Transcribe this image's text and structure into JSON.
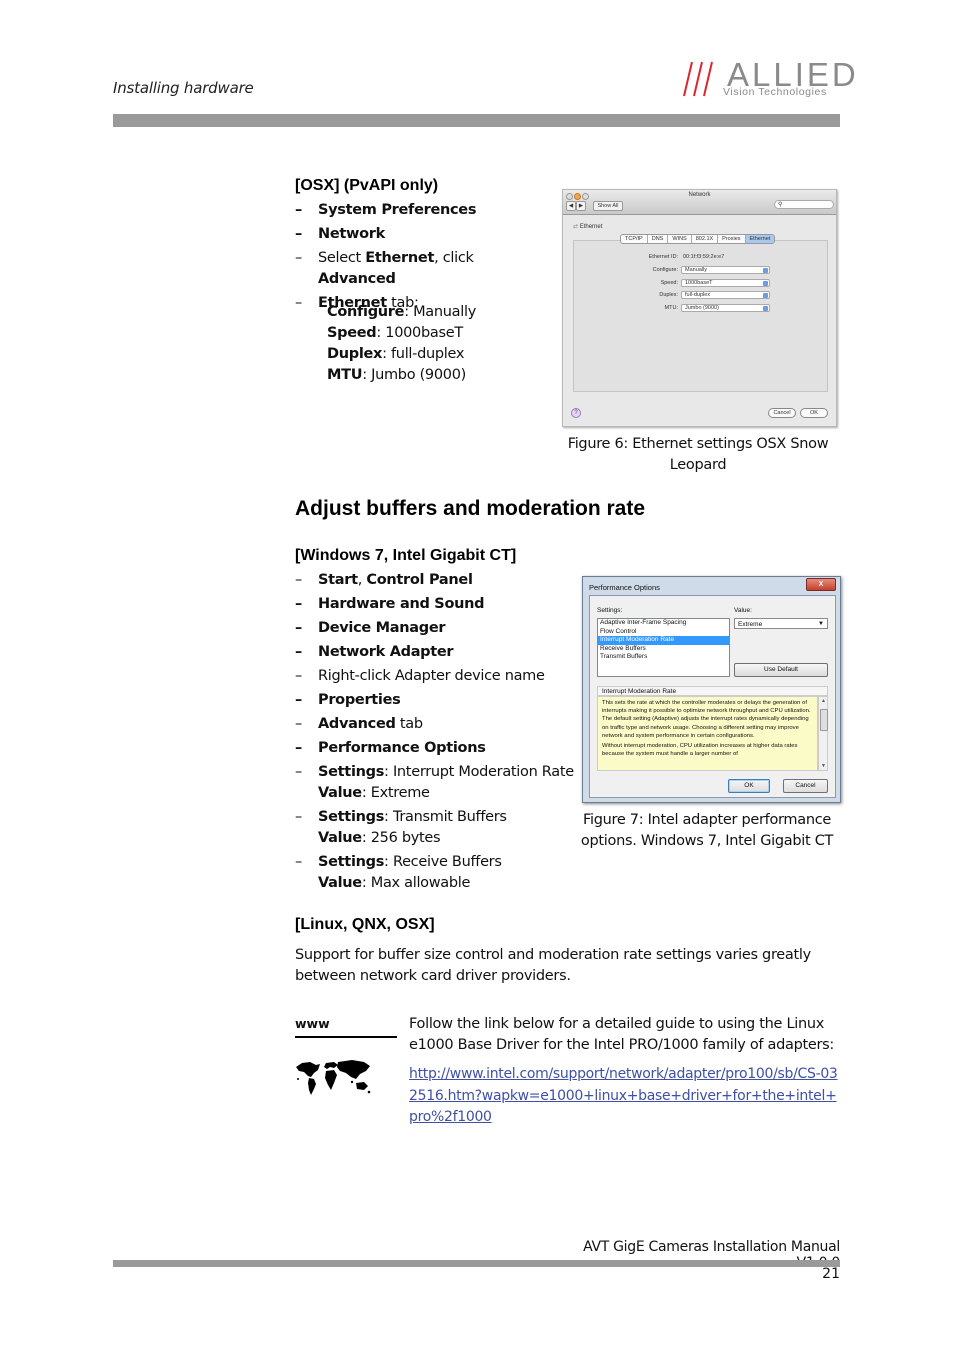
{
  "header": {
    "running_head": "Installing hardware",
    "logo": {
      "word": "ALLIED",
      "sub": "Vision Technologies",
      "slash_color": "#e0242e",
      "text_color": "#8a8a8a"
    }
  },
  "osx_section": {
    "heading": "[OSX] (PvAPI only)",
    "steps": [
      {
        "parts": [
          {
            "text": "System Preferences",
            "bold": true
          }
        ]
      },
      {
        "parts": [
          {
            "text": "Network",
            "bold": true
          }
        ]
      },
      {
        "parts": [
          {
            "text": "Select ",
            "bold": false
          },
          {
            "text": "Ethernet",
            "bold": true
          },
          {
            "text": ", click ",
            "bold": false
          },
          {
            "text": "Advanced",
            "bold": true
          }
        ]
      },
      {
        "parts": [
          {
            "text": "Ethernet",
            "bold": true
          },
          {
            "text": " tab:",
            "bold": false
          }
        ]
      }
    ],
    "params": [
      {
        "key": "Configure",
        "value": "Manually"
      },
      {
        "key": "Speed",
        "value": "1000baseT"
      },
      {
        "key": "Duplex",
        "value": "full-duplex"
      },
      {
        "key": "MTU",
        "value": "Jumbo (9000)"
      }
    ],
    "figure": {
      "window_title": "Network",
      "show_all": "Show All",
      "search_glyph": "⚲",
      "interface": "Ethernet",
      "tabs": [
        "TCP/IP",
        "DNS",
        "WINS",
        "802.1X",
        "Proxies",
        "Ethernet"
      ],
      "active_tab": "Ethernet",
      "ethernet_id_label": "Ethernet ID:",
      "ethernet_id": "00:1f:f3:59:2e:e7",
      "fields": [
        {
          "label": "Configure:",
          "value": "Manually"
        },
        {
          "label": "Speed:",
          "value": "1000baseT"
        },
        {
          "label": "Duplex:",
          "value": "full-duplex"
        },
        {
          "label": "MTU:",
          "value": "Jumbo (9000)"
        }
      ],
      "help": "?",
      "cancel": "Cancel",
      "ok": "OK"
    },
    "caption": "Figure 6: Ethernet settings OSX Snow Leopard"
  },
  "main_heading": "Adjust buffers and moderation rate",
  "win_section": {
    "heading": "[Windows 7, Intel Gigabit CT]",
    "steps": [
      {
        "parts": [
          {
            "text": "Start",
            "bold": true
          },
          {
            "text": ", ",
            "bold": false
          },
          {
            "text": "Control Panel",
            "bold": true
          }
        ]
      },
      {
        "parts": [
          {
            "text": "Hardware and Sound",
            "bold": true
          }
        ]
      },
      {
        "parts": [
          {
            "text": "Device Manager",
            "bold": true
          }
        ]
      },
      {
        "parts": [
          {
            "text": "Network Adapter",
            "bold": true
          }
        ]
      },
      {
        "parts": [
          {
            "text": "Right-click Adapter device name",
            "bold": false
          }
        ]
      },
      {
        "parts": [
          {
            "text": "Properties",
            "bold": true
          }
        ]
      },
      {
        "parts": [
          {
            "text": "Advanced",
            "bold": true
          },
          {
            "text": " tab",
            "bold": false
          }
        ]
      },
      {
        "parts": [
          {
            "text": "Performance Options",
            "bold": true
          }
        ]
      },
      {
        "parts": [
          {
            "text": "Settings",
            "bold": true
          },
          {
            "text": ": Interrupt Moderation Rate",
            "bold": false
          }
        ],
        "value_line": [
          {
            "text": "Value",
            "bold": true
          },
          {
            "text": ": Extreme",
            "bold": false
          }
        ]
      },
      {
        "parts": [
          {
            "text": "Settings",
            "bold": true
          },
          {
            "text": ": Transmit Buffers",
            "bold": false
          }
        ],
        "value_line": [
          {
            "text": "Value",
            "bold": true
          },
          {
            "text": ": 256 bytes",
            "bold": false
          }
        ]
      },
      {
        "parts": [
          {
            "text": "Settings",
            "bold": true
          },
          {
            "text": ": Receive Buffers",
            "bold": false
          }
        ],
        "value_line": [
          {
            "text": "Value",
            "bold": true
          },
          {
            "text": ": Max allowable",
            "bold": false
          }
        ]
      }
    ],
    "figure": {
      "window_title": "Performance Options",
      "close": "X",
      "settings_label": "Settings:",
      "value_label": "Value:",
      "settings_items": [
        "Adaptive Inter-Frame Spacing",
        "Flow Control",
        "Interrupt Moderation Rate",
        "Receive Buffers",
        "Transmit Buffers"
      ],
      "selected_setting": "Interrupt Moderation Rate",
      "value_selected": "Extreme",
      "use_default": "Use Default",
      "desc_heading": "Interrupt Moderation Rate",
      "desc_paragraphs": [
        "This sets the rate at which the controller moderates or delays the generation of interrupts making it possible to optimize network throughput and CPU utilization. The default setting (Adaptive) adjusts the interrupt rates dynamically depending on traffic type and network usage. Choosing a different setting may improve network and system performance in certain configurations.",
        "Without interrupt moderation, CPU utilization increases at higher data rates because the system must handle a larger number of"
      ],
      "ok": "OK",
      "cancel": "Cancel"
    },
    "caption": "Figure 7: Intel adapter performance options. Windows 7, Intel Gigabit CT"
  },
  "linux_section": {
    "heading": "[Linux, QNX, OSX]",
    "body": "Support for buffer size control and moderation rate settings varies greatly between network card driver providers."
  },
  "www_box": {
    "label": "www",
    "text": "Follow the link below for a detailed guide to using the Linux e1000 Base Driver for the Intel PRO/1000 family of adapters:",
    "link": "http://www.intel.com/support/network/adapter/pro100/sb/CS-032516.htm?wapkw=e1000+linux+base+driver+for+the+intel+pro%2f1000",
    "link_color": "#3f50a6"
  },
  "footer": {
    "title": "AVT GigE Cameras Installation Manual V1.0.0",
    "page": "21"
  }
}
